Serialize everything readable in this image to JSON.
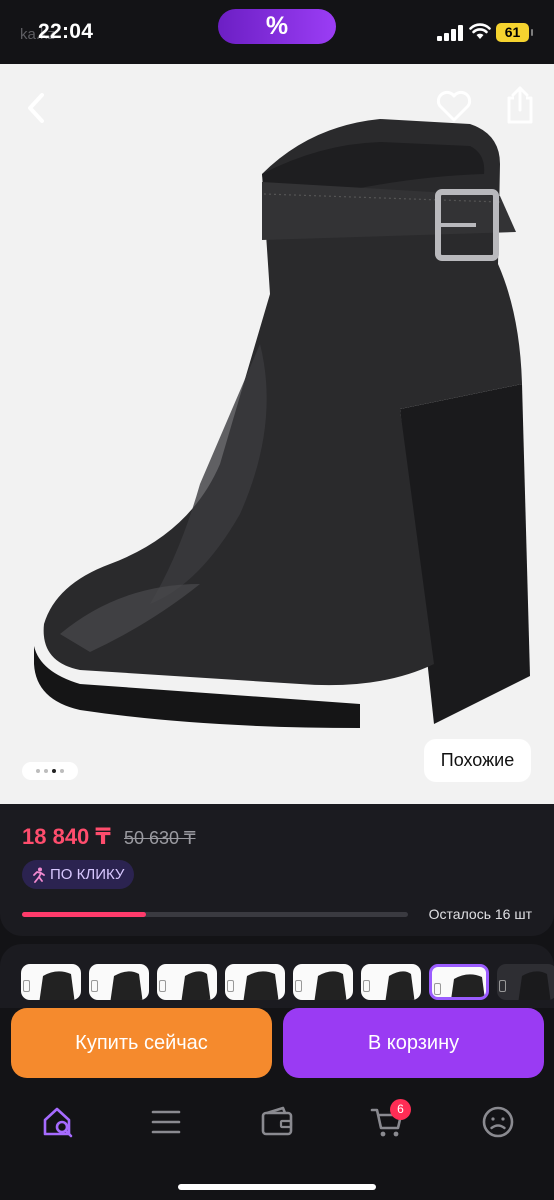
{
  "status_bar": {
    "time": "22:04",
    "ghost_text": "ka.kz",
    "promo_symbol": "%",
    "battery": "61"
  },
  "gallery": {
    "similar_label": "Похожие",
    "dots": [
      false,
      false,
      true,
      false
    ]
  },
  "product": {
    "price": "18 840 ₸",
    "old_price": "50 630 ₸",
    "promo_label": "ПО КЛИКУ",
    "stock_label": "Осталось 16 шт",
    "stock_progress_percent": 32
  },
  "variants": [
    {
      "selected": false
    },
    {
      "selected": false
    },
    {
      "selected": false
    },
    {
      "selected": false
    },
    {
      "selected": false
    },
    {
      "selected": false
    },
    {
      "selected": true
    },
    {
      "selected": false
    }
  ],
  "actions": {
    "buy_now": "Купить сейчас",
    "add_to_cart": "В корзину"
  },
  "bottom_nav": {
    "items": [
      "home-search-icon",
      "catalog-icon",
      "wallet-icon",
      "cart-icon",
      "profile-icon"
    ],
    "cart_count": "6"
  },
  "colors": {
    "price": "#ff4d6d",
    "buy": "#f58a2d",
    "cart": "#9a3bf3",
    "accent": "#9b5cff"
  }
}
